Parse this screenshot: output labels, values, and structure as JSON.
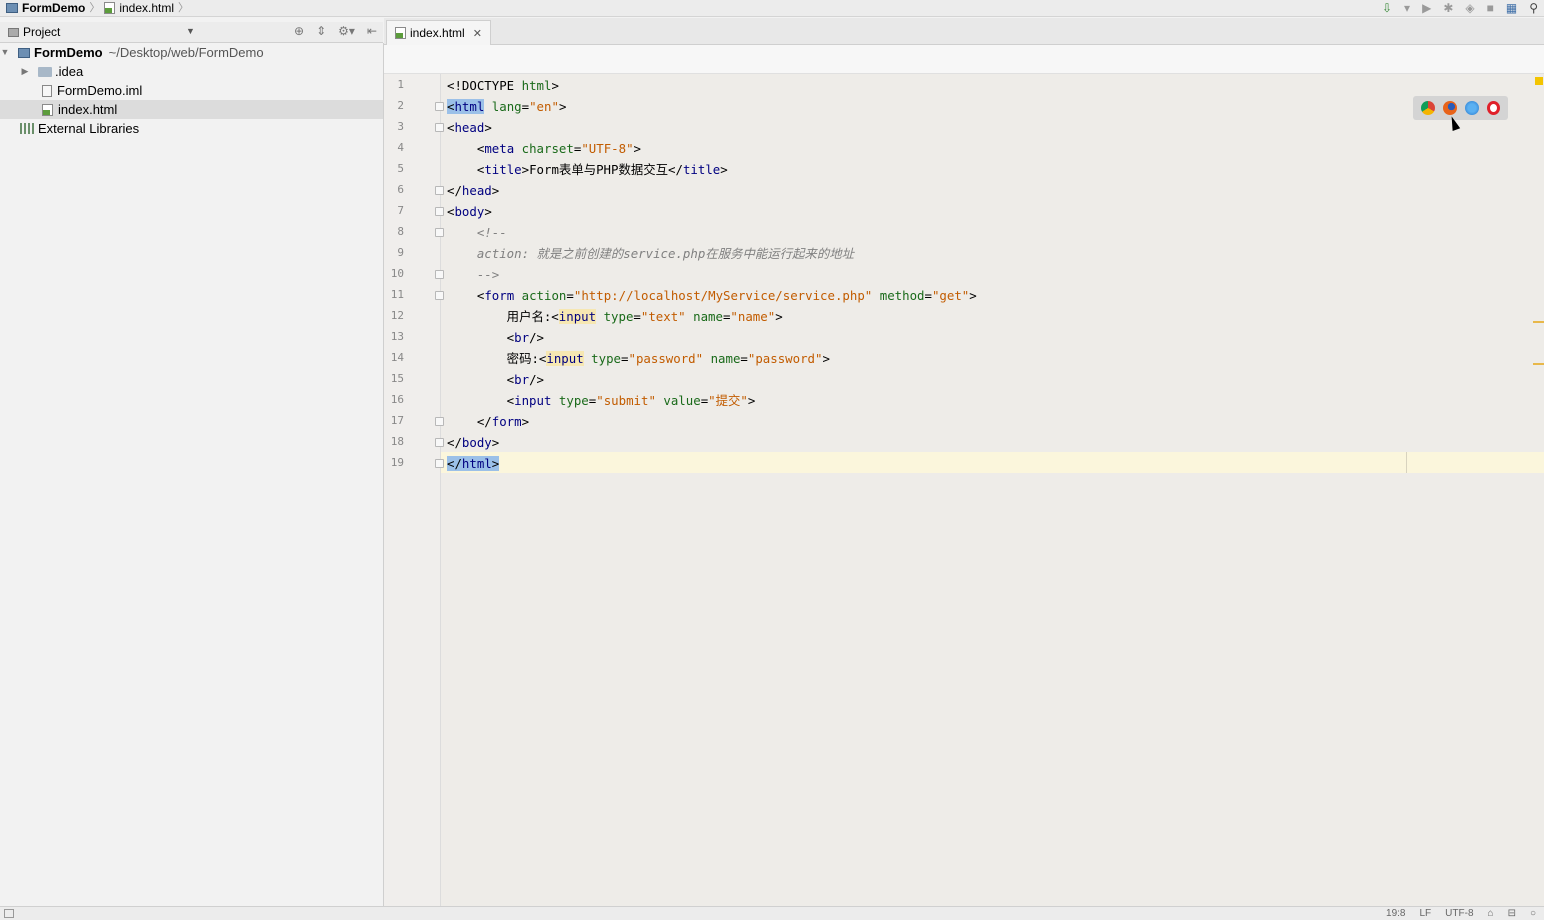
{
  "breadcrumb": {
    "project": "FormDemo",
    "file": "index.html"
  },
  "toolbar": {
    "icons": [
      "make-icon",
      "dropdown-icon",
      "run-icon",
      "debug-icon",
      "coverage-icon",
      "stop-icon",
      "structure-icon",
      "search-icon"
    ]
  },
  "project_panel": {
    "title": "Project",
    "root": {
      "name": "FormDemo",
      "path": "~/Desktop/web/FormDemo"
    },
    "items": [
      {
        "name": ".idea",
        "type": "folder"
      },
      {
        "name": "FormDemo.iml",
        "type": "iml"
      },
      {
        "name": "index.html",
        "type": "html",
        "selected": true
      },
      {
        "name": "External Libraries",
        "type": "libraries"
      }
    ]
  },
  "editor": {
    "tab": "index.html",
    "line_numbers": [
      "1",
      "2",
      "3",
      "4",
      "5",
      "6",
      "7",
      "8",
      "9",
      "10",
      "11",
      "12",
      "13",
      "14",
      "15",
      "16",
      "17",
      "18",
      "19"
    ],
    "current_line": 19
  },
  "code": {
    "l1_a": "<!DOCTYPE ",
    "l1_b": "html",
    "l1_c": ">",
    "l2_a": "<",
    "l2_b": "html",
    "l2_c": " ",
    "l2_d": "lang",
    "l2_e": "=",
    "l2_f": "\"en\"",
    "l2_g": ">",
    "l3_a": "<",
    "l3_b": "head",
    "l3_c": ">",
    "l4_a": "    <",
    "l4_b": "meta",
    "l4_c": " ",
    "l4_d": "charset",
    "l4_e": "=",
    "l4_f": "\"UTF-8\"",
    "l4_g": ">",
    "l5_a": "    <",
    "l5_b": "title",
    "l5_c": ">Form表单与PHP数据交互</",
    "l5_d": "title",
    "l5_e": ">",
    "l6_a": "</",
    "l6_b": "head",
    "l6_c": ">",
    "l7_a": "<",
    "l7_b": "body",
    "l7_c": ">",
    "l8": "    <!--",
    "l9": "    action: 就是之前创建的service.php在服务中能运行起来的地址",
    "l10": "    -->",
    "l11_a": "    <",
    "l11_b": "form",
    "l11_c": " ",
    "l11_d": "action",
    "l11_e": "=",
    "l11_f": "\"http://localhost/MyService/service.php\"",
    "l11_g": " ",
    "l11_h": "method",
    "l11_i": "=",
    "l11_j": "\"get\"",
    "l11_k": ">",
    "l12_a": "        用户名:<",
    "l12_b": "input",
    "l12_c": " ",
    "l12_d": "type",
    "l12_e": "=",
    "l12_f": "\"text\"",
    "l12_g": " ",
    "l12_h": "name",
    "l12_i": "=",
    "l12_j": "\"name\"",
    "l12_k": ">",
    "l13_a": "        <",
    "l13_b": "br",
    "l13_c": "/>",
    "l14_a": "        密码:<",
    "l14_b": "input",
    "l14_c": " ",
    "l14_d": "type",
    "l14_e": "=",
    "l14_f": "\"password\"",
    "l14_g": " ",
    "l14_h": "name",
    "l14_i": "=",
    "l14_j": "\"password\"",
    "l14_k": ">",
    "l15_a": "        <",
    "l15_b": "br",
    "l15_c": "/>",
    "l16_a": "        <",
    "l16_b": "input",
    "l16_c": " ",
    "l16_d": "type",
    "l16_e": "=",
    "l16_f": "\"submit\"",
    "l16_g": " ",
    "l16_h": "value",
    "l16_i": "=",
    "l16_j": "\"提交\"",
    "l16_k": ">",
    "l17_a": "    </",
    "l17_b": "form",
    "l17_c": ">",
    "l18_a": "</",
    "l18_b": "body",
    "l18_c": ">",
    "l19_a": "</",
    "l19_b": "html",
    "l19_c": ">"
  },
  "browser_popup": {
    "browsers": [
      "chrome-icon",
      "firefox-icon",
      "safari-icon",
      "opera-icon"
    ]
  },
  "statusbar": {
    "position": "19:8",
    "line_sep": "LF",
    "encoding": "UTF-8"
  },
  "colors": {
    "tag": "#000080",
    "attr_name": "#1a6a1a",
    "string": "#c25c00",
    "comment": "#808080",
    "current_line": "#fbf6dc",
    "selection": "#9bc0e8"
  }
}
